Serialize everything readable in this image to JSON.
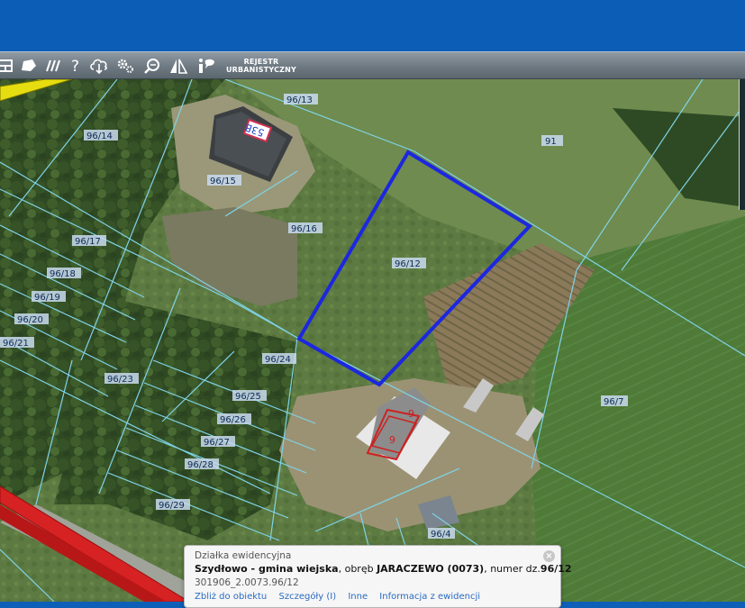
{
  "toolbar": {
    "tools": [
      "layers-icon",
      "shape-icon",
      "hatch-icon",
      "help-icon",
      "cloud-download-icon",
      "settings-icon",
      "zoom-search-icon",
      "measure-icon",
      "info-icon"
    ],
    "registry_label_line1": "REJESTR",
    "registry_label_line2": "URBANISTYCZNY"
  },
  "map": {
    "building_badge": "53B",
    "parcels": [
      "96/13",
      "96/14",
      "91",
      "96/15",
      "96/16",
      "96/17",
      "96/12",
      "96/18",
      "96/19",
      "96/20",
      "96/21",
      "96/24",
      "96/23",
      "96/25",
      "96/26",
      "96/27",
      "96/28",
      "96/29",
      "96/7",
      "96/4"
    ],
    "building_marks": [
      "9",
      "9"
    ]
  },
  "popup": {
    "title": "Działka ewidencyjna",
    "locality": "Szydłowo - gmina wiejska",
    "precinct_prefix": ", obręb ",
    "precinct": "JARACZEWO (0073)",
    "number_prefix": ", numer dz.",
    "number": "96/12",
    "identifier": "301906_2.0073.96/12",
    "links": [
      "Zbliż do obiektu",
      "Szczegóły (I)",
      "Inne",
      "Informacja z ewidencji"
    ]
  }
}
